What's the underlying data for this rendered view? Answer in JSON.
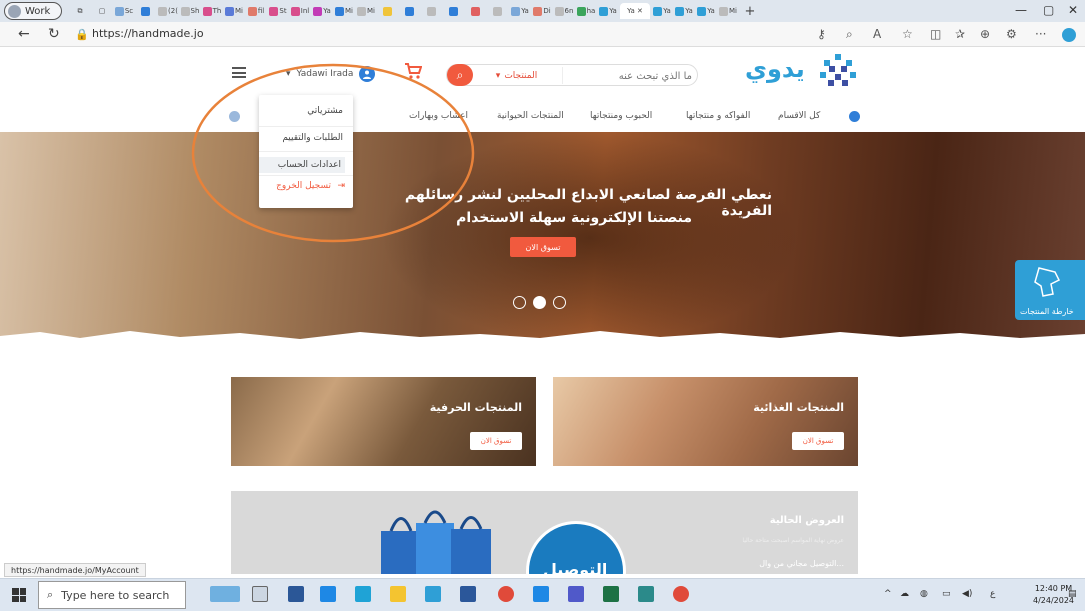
{
  "browser": {
    "profile_label": "Work",
    "tabs": [
      "Sc",
      "(2(",
      "Sh",
      "Th",
      "Mi",
      "fil",
      "St",
      "Inl",
      "Ya",
      "Mi",
      "Mi",
      "Ya",
      "Di",
      "6n",
      "ha",
      "Ya",
      "Ya",
      "Ya",
      "Ya",
      "Mi"
    ],
    "active_tab": "Ya",
    "url": "https://handmade.jo"
  },
  "site": {
    "logo_text": "يدوي",
    "search_placeholder": "ما الذي تبحث عنه",
    "search_category": "المنتجات",
    "user_name": "Yadawi Irada",
    "nav_items": [
      "كل الاقسام",
      "الفواكه و منتجاتها",
      "الحبوب ومنتجاتها",
      "المنتجات الحيوانية",
      "اعشاب وبهارات"
    ],
    "user_menu": [
      "مشترياتي",
      "الطلبات والتقييم",
      "اعدادات الحساب",
      "تسجيل الخروج"
    ]
  },
  "hero": {
    "line1": "نعطي الفرصة لصانعي الابداع المحليين لنشر رسائلهم الفريدة",
    "line2": "منصتنا الإلكترونية سهلة الاستخدام",
    "button": "تسوق الان",
    "dots": 3,
    "active_dot": 2
  },
  "map_widget": {
    "label": "خارطة المنتجات"
  },
  "cards": [
    {
      "title": "المنتجات الحرفية",
      "button": "تسوق الان"
    },
    {
      "title": "المنتجات الغذائية",
      "button": "تسوق الان"
    }
  ],
  "offers": {
    "title": "العروض الحالية",
    "subtitle": "عروض نهاية المواسم اصبحت متاحة حاليا",
    "detail": "...التوصيل مجاني من وال",
    "badge": "التوصيل"
  },
  "status_url": "https://handmade.jo/MyAccount",
  "taskbar": {
    "search_placeholder": "Type here to search",
    "time": "12:40 PM",
    "date": "4/24/2024"
  },
  "colors": {
    "accent": "#f15a3e",
    "brand": "#2f9fd6",
    "annotation_circle": "#e8823a"
  }
}
